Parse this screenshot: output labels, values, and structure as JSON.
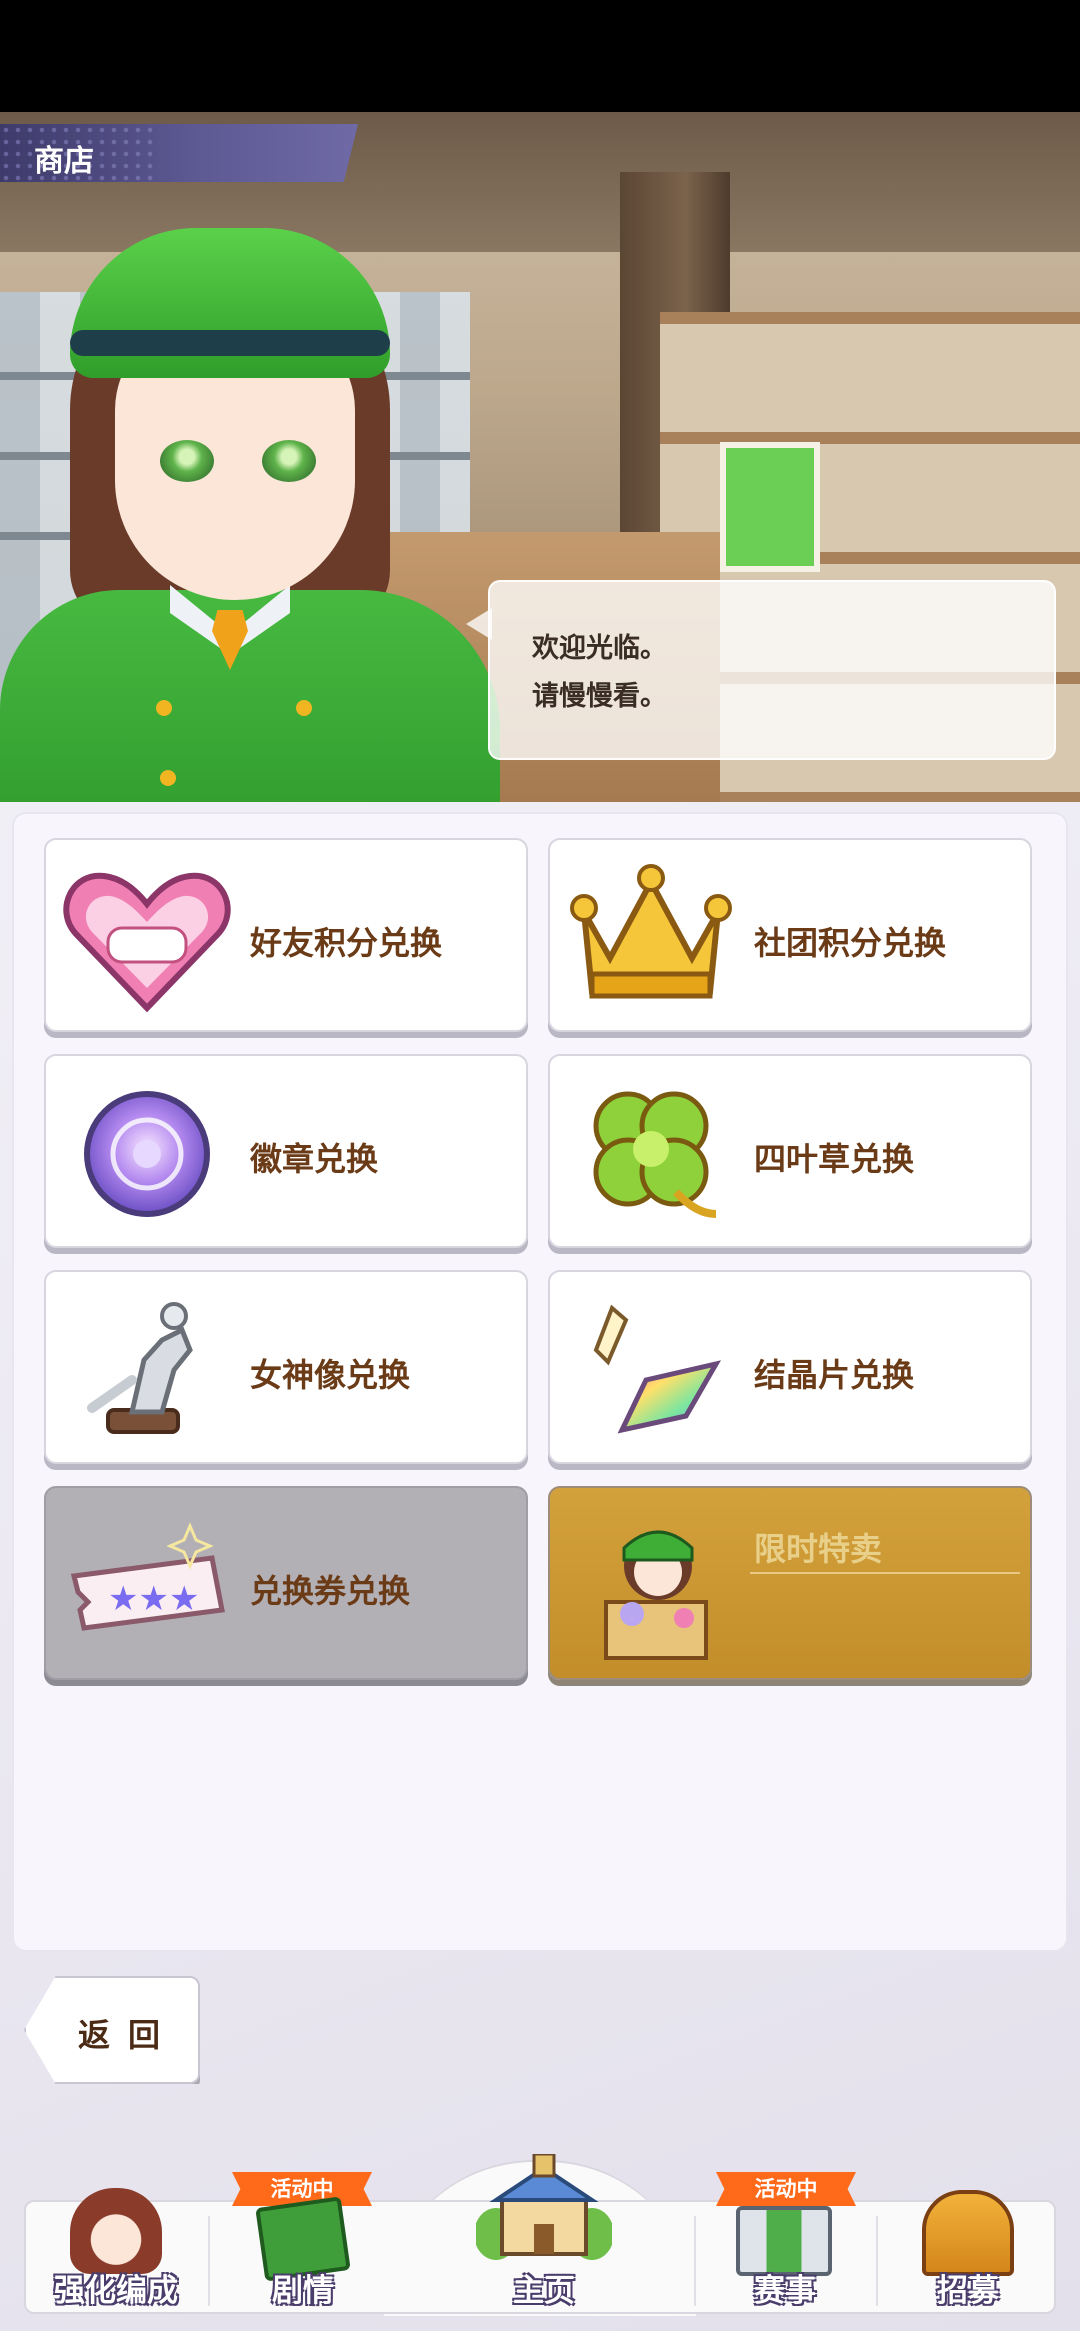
{
  "header": {
    "title": "商店"
  },
  "dialog": {
    "line1": "欢迎光临。",
    "line2": "请慢慢看。"
  },
  "shop_items": [
    {
      "label": "好友积分兑换",
      "icon": "handshake-heart-icon",
      "state": "enabled"
    },
    {
      "label": "社团积分兑换",
      "icon": "crown-icon",
      "state": "enabled"
    },
    {
      "label": "徽章兑换",
      "icon": "badge-medal-icon",
      "state": "enabled"
    },
    {
      "label": "四叶草兑换",
      "icon": "four-leaf-clover-icon",
      "state": "enabled"
    },
    {
      "label": "女神像兑换",
      "icon": "goddess-statue-icon",
      "state": "enabled"
    },
    {
      "label": "结晶片兑换",
      "icon": "crystal-shard-icon",
      "state": "enabled"
    },
    {
      "label": "兑换券兑换",
      "icon": "ticket-icon",
      "state": "disabled"
    },
    {
      "label": "限时特卖",
      "icon": "limited-sale-icon",
      "state": "disabled"
    }
  ],
  "back_button": {
    "label": "返回"
  },
  "bottom_nav": {
    "items": [
      {
        "label": "强化编成",
        "icon": "enhance-team-icon",
        "badge": ""
      },
      {
        "label": "剧情",
        "icon": "story-book-icon",
        "badge": "活动中"
      },
      {
        "label": "主页",
        "icon": "home-building-icon",
        "badge": ""
      },
      {
        "label": "赛事",
        "icon": "race-gate-icon",
        "badge": "活动中"
      },
      {
        "label": "招募",
        "icon": "recruit-gate-icon",
        "badge": ""
      }
    ]
  },
  "colors": {
    "title_tab": "#5d5993",
    "card_label": "#6a3b16",
    "badge": "#ff6a1a",
    "sale_card": "#c9962f"
  }
}
